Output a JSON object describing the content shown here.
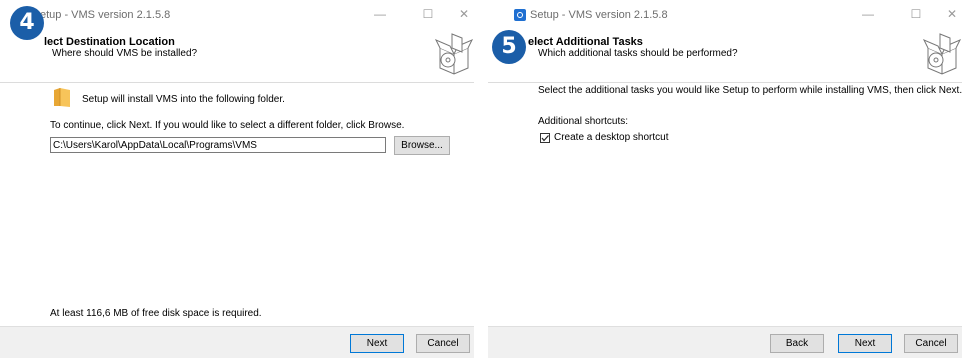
{
  "step4": {
    "badge": "4",
    "window_title": "etup - VMS version 2.1.5.8",
    "header_title": "lect Destination Location",
    "header_subtitle": "Where should VMS be installed?",
    "intro_text": "Setup will install VMS into the following folder.",
    "instruction_text": "To continue, click Next. If you would like to select a different folder, click Browse.",
    "install_path": "C:\\Users\\Karol\\AppData\\Local\\Programs\\VMS",
    "browse_label": "Browse...",
    "disk_space_text": "At least 116,6 MB of free disk space is required.",
    "next_label": "Next",
    "cancel_label": "Cancel"
  },
  "step5": {
    "badge": "5",
    "window_title": "Setup - VMS version 2.1.5.8",
    "header_title": "elect Additional Tasks",
    "header_subtitle": "Which additional tasks should be performed?",
    "intro_text": "Select the additional tasks you would like Setup to perform while installing VMS, then click Next.",
    "shortcuts_label": "Additional shortcuts:",
    "desktop_shortcut_label": "Create a desktop shortcut",
    "desktop_shortcut_checked": true,
    "back_label": "Back",
    "next_label": "Next",
    "cancel_label": "Cancel"
  },
  "window_controls": {
    "minimize": "—",
    "maximize": "☐",
    "close": "✕"
  },
  "colors": {
    "badge": "#1b5ea8",
    "button_focus": "#0078d7",
    "footer_bg": "#f0f0f0"
  },
  "icons": {
    "app": "setup-app-icon",
    "wizard": "installer-box-icon",
    "folder": "folder-icon",
    "checkbox": "checkmark-icon"
  }
}
